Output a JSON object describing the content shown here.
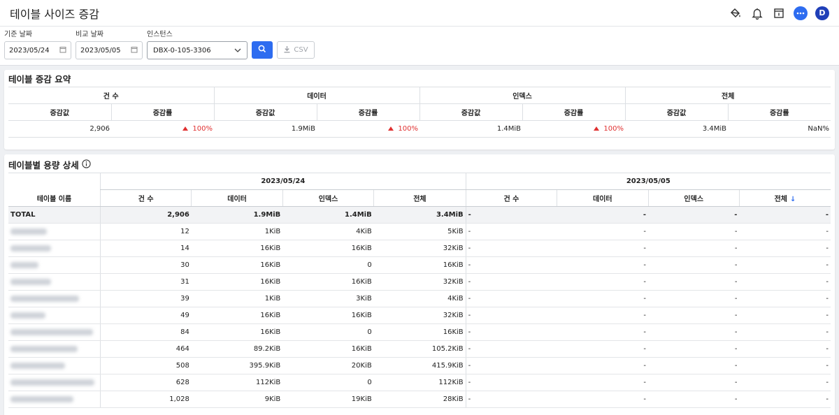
{
  "header": {
    "title": "테이블 사이즈 증감",
    "avatar_letter": "D"
  },
  "filters": {
    "base_date_label": "기준 날짜",
    "base_date_value": "2023/05/24",
    "compare_date_label": "비교 날짜",
    "compare_date_value": "2023/05/05",
    "instance_label": "인스턴스",
    "instance_value": "DBX-0-105-3306",
    "csv_label": "CSV"
  },
  "summary": {
    "title": "테이블 증감 요약",
    "groups": [
      "건 수",
      "데이터",
      "인덱스",
      "전체"
    ],
    "sub_headers": [
      "증감값",
      "증감률"
    ],
    "values": [
      {
        "delta": "2,906",
        "rate": "100%",
        "rate_up": true
      },
      {
        "delta": "1.9MiB",
        "rate": "100%",
        "rate_up": true
      },
      {
        "delta": "1.4MiB",
        "rate": "100%",
        "rate_up": true
      },
      {
        "delta": "3.4MiB",
        "rate": "NaN%",
        "rate_up": false
      }
    ]
  },
  "detail": {
    "title": "테이블별 용량 상세",
    "name_header": "테이블 이름",
    "date1": "2023/05/24",
    "date2": "2023/05/05",
    "col_headers": [
      "건 수",
      "데이터",
      "인덱스",
      "전체"
    ],
    "sort_indicator": "↓",
    "total": {
      "name": "TOTAL",
      "d1": [
        "2,906",
        "1.9MiB",
        "1.4MiB",
        "3.4MiB"
      ],
      "d2": [
        "-",
        "-",
        "-",
        "-"
      ]
    },
    "rows": [
      {
        "d1": [
          "12",
          "1KiB",
          "4KiB",
          "5KiB"
        ],
        "d2": [
          "-",
          "-",
          "-",
          "-"
        ]
      },
      {
        "d1": [
          "14",
          "16KiB",
          "16KiB",
          "32KiB"
        ],
        "d2": [
          "-",
          "-",
          "-",
          "-"
        ]
      },
      {
        "d1": [
          "30",
          "16KiB",
          "0",
          "16KiB"
        ],
        "d2": [
          "-",
          "-",
          "-",
          "-"
        ]
      },
      {
        "d1": [
          "31",
          "16KiB",
          "16KiB",
          "32KiB"
        ],
        "d2": [
          "-",
          "-",
          "-",
          "-"
        ]
      },
      {
        "d1": [
          "39",
          "1KiB",
          "3KiB",
          "4KiB"
        ],
        "d2": [
          "-",
          "-",
          "-",
          "-"
        ]
      },
      {
        "d1": [
          "49",
          "16KiB",
          "16KiB",
          "32KiB"
        ],
        "d2": [
          "-",
          "-",
          "-",
          "-"
        ]
      },
      {
        "d1": [
          "84",
          "16KiB",
          "0",
          "16KiB"
        ],
        "d2": [
          "-",
          "-",
          "-",
          "-"
        ]
      },
      {
        "d1": [
          "464",
          "89.2KiB",
          "16KiB",
          "105.2KiB"
        ],
        "d2": [
          "-",
          "-",
          "-",
          "-"
        ]
      },
      {
        "d1": [
          "508",
          "395.9KiB",
          "20KiB",
          "415.9KiB"
        ],
        "d2": [
          "-",
          "-",
          "-",
          "-"
        ]
      },
      {
        "d1": [
          "628",
          "112KiB",
          "0",
          "112KiB"
        ],
        "d2": [
          "-",
          "-",
          "-",
          "-"
        ]
      },
      {
        "d1": [
          "1,028",
          "9KiB",
          "19KiB",
          "28KiB"
        ],
        "d2": [
          "-",
          "-",
          "-",
          "-"
        ]
      }
    ]
  },
  "colors": {
    "accent": "#2d6cf0",
    "increase": "#e03131",
    "avatar": "#1f3fb8"
  }
}
